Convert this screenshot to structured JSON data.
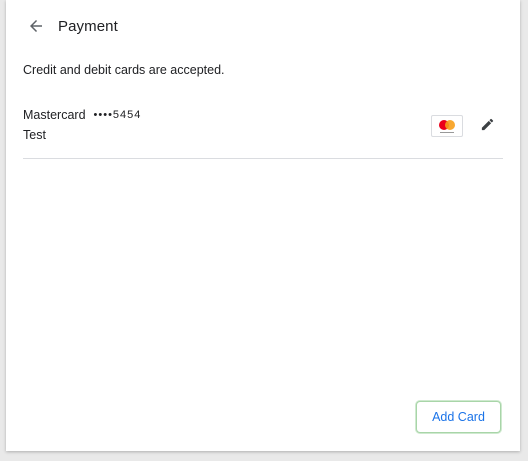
{
  "header": {
    "title": "Payment",
    "back_icon": "arrow-back-icon"
  },
  "description": "Credit and debit cards are accepted.",
  "cards": [
    {
      "brand": "Mastercard",
      "masked_number": "••••5454",
      "name": "Test",
      "logo_icon": "mastercard-logo",
      "edit_icon": "pencil-icon"
    }
  ],
  "actions": {
    "add_card_label": "Add Card"
  },
  "colors": {
    "accent": "#1a73e8",
    "text": "#202124",
    "divider": "#dadce0",
    "focus_ring": "#a8d5a8"
  }
}
